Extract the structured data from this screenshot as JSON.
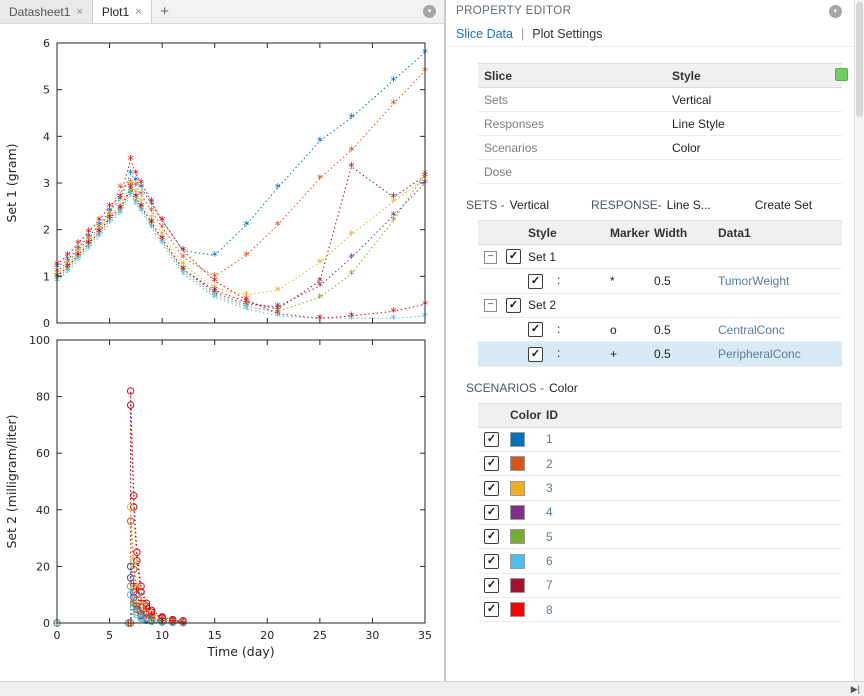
{
  "chrome": {
    "bottom_scroll_icon": "▶|"
  },
  "left": {
    "tabs": [
      {
        "label": "Datasheet1",
        "close": "×",
        "active": false
      },
      {
        "label": "Plot1",
        "close": "×",
        "active": true
      }
    ],
    "new_tab": "+"
  },
  "property_editor": {
    "title": "PROPERTY EDITOR",
    "tab_separator": "|",
    "tabs": [
      {
        "label": "Slice Data",
        "active": true
      },
      {
        "label": "Plot Settings",
        "active": false
      }
    ],
    "slice_table": {
      "headers": [
        "Slice",
        "Style"
      ],
      "rows": [
        {
          "slice": "Sets",
          "style": "Vertical"
        },
        {
          "slice": "Responses",
          "style": "Line Style"
        },
        {
          "slice": "Scenarios",
          "style": "Color"
        },
        {
          "slice": "Dose",
          "style": ""
        }
      ]
    },
    "sets_section": {
      "label": "SETS -",
      "value": "Vertical",
      "response_label": "RESPONSE-",
      "response_value": "Line S...",
      "create_button": "Create Set"
    },
    "sets_table": {
      "headers": [
        "",
        "Style",
        "Marker",
        "Width",
        "Data1"
      ],
      "rows": [
        {
          "type": "group",
          "label": "Set 1",
          "checked": true,
          "expanded": true
        },
        {
          "type": "item",
          "style": ":",
          "marker": "*",
          "width": "0.5",
          "data": "TumorWeight",
          "checked": true,
          "selected": false
        },
        {
          "type": "group",
          "label": "Set 2",
          "checked": true,
          "expanded": true
        },
        {
          "type": "item",
          "style": ":",
          "marker": "o",
          "width": "0.5",
          "data": "CentralConc",
          "checked": true,
          "selected": false
        },
        {
          "type": "item",
          "style": ":",
          "marker": "+",
          "width": "0.5",
          "data": "PeripheralConc",
          "checked": true,
          "selected": true
        }
      ]
    },
    "scenarios_section": {
      "label": "SCENARIOS -",
      "value": "Color"
    },
    "scenarios_table": {
      "headers": [
        "",
        "Color",
        "ID"
      ],
      "rows": [
        {
          "id": "1",
          "color": "#0072BD",
          "checked": true
        },
        {
          "id": "2",
          "color": "#D95319",
          "checked": true
        },
        {
          "id": "3",
          "color": "#EDB120",
          "checked": true
        },
        {
          "id": "4",
          "color": "#7E2F8E",
          "checked": true
        },
        {
          "id": "5",
          "color": "#77AC30",
          "checked": true
        },
        {
          "id": "6",
          "color": "#4DBEEE",
          "checked": true
        },
        {
          "id": "7",
          "color": "#A2142F",
          "checked": true
        },
        {
          "id": "8",
          "color": "#FF0000",
          "checked": true
        }
      ]
    }
  },
  "chart_data": [
    {
      "name": "set1",
      "type": "line",
      "title": "",
      "ylabel": "Set 1 (gram)",
      "xlabel": "",
      "xlim": [
        0,
        35
      ],
      "ylim": [
        0,
        6
      ],
      "xticks": [
        0,
        5,
        10,
        15,
        20,
        25,
        30,
        35
      ],
      "yticks": [
        0,
        1,
        2,
        3,
        4,
        5,
        6
      ],
      "show_x_labels": false,
      "grid": false,
      "line_style": "dotted",
      "x": [
        0,
        1,
        2,
        3,
        4,
        5,
        6,
        7,
        7.5,
        8,
        9,
        10,
        12,
        15,
        18,
        21,
        25,
        28,
        32,
        35
      ],
      "series": [
        {
          "name": "TumorWeight scenario 1",
          "color": "#0072BD",
          "marker": "*",
          "values": [
            1.2,
            1.35,
            1.6,
            1.85,
            2.1,
            2.4,
            2.65,
            3.2,
            3.05,
            2.9,
            2.55,
            2.2,
            1.55,
            1.45,
            2.1,
            2.9,
            3.9,
            4.4,
            5.2,
            5.8
          ]
        },
        {
          "name": "TumorWeight scenario 2",
          "color": "#D95319",
          "marker": "*",
          "values": [
            1.1,
            1.3,
            1.55,
            1.8,
            2.05,
            2.35,
            2.9,
            3.0,
            2.95,
            2.75,
            2.4,
            2.05,
            1.4,
            1.0,
            1.45,
            2.1,
            3.1,
            3.7,
            4.7,
            5.4
          ]
        },
        {
          "name": "TumorWeight scenario 3",
          "color": "#EDB120",
          "marker": "*",
          "values": [
            1.05,
            1.25,
            1.5,
            1.75,
            2.0,
            2.3,
            2.5,
            2.95,
            2.8,
            2.6,
            2.25,
            1.9,
            1.25,
            0.75,
            0.6,
            0.7,
            1.3,
            1.9,
            2.6,
            3.1
          ]
        },
        {
          "name": "TumorWeight scenario 4",
          "color": "#7E2F8E",
          "marker": "*",
          "values": [
            1.0,
            1.2,
            1.45,
            1.7,
            1.95,
            2.25,
            2.45,
            2.85,
            2.7,
            2.5,
            2.15,
            1.8,
            1.15,
            0.65,
            0.4,
            0.35,
            0.8,
            1.4,
            2.3,
            3.0
          ]
        },
        {
          "name": "TumorWeight scenario 5",
          "color": "#77AC30",
          "marker": "*",
          "values": [
            0.95,
            1.15,
            1.4,
            1.65,
            1.9,
            2.2,
            2.4,
            2.8,
            2.6,
            2.45,
            2.1,
            1.75,
            1.1,
            0.6,
            0.35,
            0.25,
            0.55,
            1.05,
            2.2,
            3.2
          ]
        },
        {
          "name": "TumorWeight scenario 6",
          "color": "#4DBEEE",
          "marker": "*",
          "values": [
            0.9,
            1.1,
            1.35,
            1.6,
            1.85,
            2.15,
            2.35,
            2.75,
            2.55,
            2.4,
            2.05,
            1.7,
            1.05,
            0.55,
            0.3,
            0.15,
            0.1,
            0.1,
            0.1,
            0.15
          ]
        },
        {
          "name": "TumorWeight scenario 7",
          "color": "#A2142F",
          "marker": "*",
          "values": [
            1.0,
            1.2,
            1.45,
            1.7,
            1.95,
            2.25,
            2.45,
            2.9,
            2.7,
            2.5,
            2.15,
            1.8,
            1.15,
            0.7,
            0.45,
            0.3,
            0.9,
            3.35,
            2.7,
            3.15
          ]
        },
        {
          "name": "TumorWeight scenario 8",
          "color": "#FF0000",
          "marker": "*",
          "values": [
            1.25,
            1.45,
            1.7,
            1.95,
            2.2,
            2.5,
            2.7,
            3.5,
            3.2,
            3.0,
            2.6,
            2.2,
            1.55,
            0.9,
            0.5,
            0.2,
            0.1,
            0.15,
            0.25,
            0.4
          ]
        }
      ]
    },
    {
      "name": "set2",
      "type": "line",
      "title": "",
      "ylabel": "Set 2 (milligram/liter)",
      "xlabel": "Time (day)",
      "xlim": [
        0,
        35
      ],
      "ylim": [
        0,
        100
      ],
      "xticks": [
        0,
        5,
        10,
        15,
        20,
        25,
        30,
        35
      ],
      "yticks": [
        0,
        20,
        40,
        60,
        80,
        100
      ],
      "show_x_labels": true,
      "grid": false,
      "line_style": "dotted",
      "x": [
        0,
        6.8,
        7,
        7,
        7.3,
        7.6,
        8,
        8.5,
        9,
        10,
        11,
        12
      ],
      "series": [
        {
          "name": "CentralConc scenario 8",
          "color": "#FF0000",
          "marker": "o",
          "values": [
            0,
            0,
            0,
            82,
            45,
            25,
            13,
            7,
            4.5,
            2.2,
            1.2,
            0.8
          ]
        },
        {
          "name": "CentralConc scenario 7",
          "color": "#A2142F",
          "marker": "o",
          "values": [
            0,
            0,
            0,
            77,
            41,
            22,
            11,
            6,
            3.8,
            1.8,
            1,
            0.6
          ]
        },
        {
          "name": "CentralConc scenario 3",
          "color": "#EDB120",
          "marker": "o",
          "values": [
            0,
            0,
            0,
            41,
            22,
            12,
            6.5,
            3.5,
            2.2,
            1.1,
            0.6,
            0.4
          ]
        },
        {
          "name": "CentralConc scenario 2",
          "color": "#D95319",
          "marker": "o",
          "values": [
            0,
            0,
            0,
            36,
            19,
            10,
            5.5,
            3,
            1.9,
            0.9,
            0.5,
            0.3
          ]
        },
        {
          "name": "CentralConc scenario 1",
          "color": "#0072BD",
          "marker": "o",
          "values": [
            0,
            0,
            0,
            20,
            11,
            6,
            3.2,
            1.8,
            1.1,
            0.5,
            0.3,
            0.2
          ]
        },
        {
          "name": "CentralConc scenario 4",
          "color": "#7E2F8E",
          "marker": "o",
          "values": [
            0,
            0,
            0,
            16,
            9,
            4.8,
            2.6,
            1.4,
            0.9,
            0.4,
            0.25,
            0.15
          ]
        },
        {
          "name": "CentralConc scenario 5",
          "color": "#77AC30",
          "marker": "o",
          "values": [
            0,
            0,
            0,
            13,
            7,
            3.9,
            2.1,
            1.1,
            0.7,
            0.35,
            0.2,
            0.1
          ]
        },
        {
          "name": "CentralConc scenario 6",
          "color": "#4DBEEE",
          "marker": "o",
          "values": [
            0,
            0,
            0,
            10,
            5.5,
            3,
            1.6,
            0.9,
            0.55,
            0.3,
            0.15,
            0.1
          ]
        },
        {
          "name": "PeripheralConc scenario 8",
          "color": "#FF0000",
          "marker": "+",
          "values": [
            0,
            0,
            0,
            0,
            14,
            12,
            8,
            5,
            3.2,
            1.6,
            0.9,
            0.5
          ]
        },
        {
          "name": "PeripheralConc scenario 2",
          "color": "#D95319",
          "marker": "+",
          "values": [
            0,
            0,
            0,
            0,
            7,
            6,
            4,
            2.5,
            1.6,
            0.8,
            0.45,
            0.25
          ]
        }
      ]
    }
  ]
}
